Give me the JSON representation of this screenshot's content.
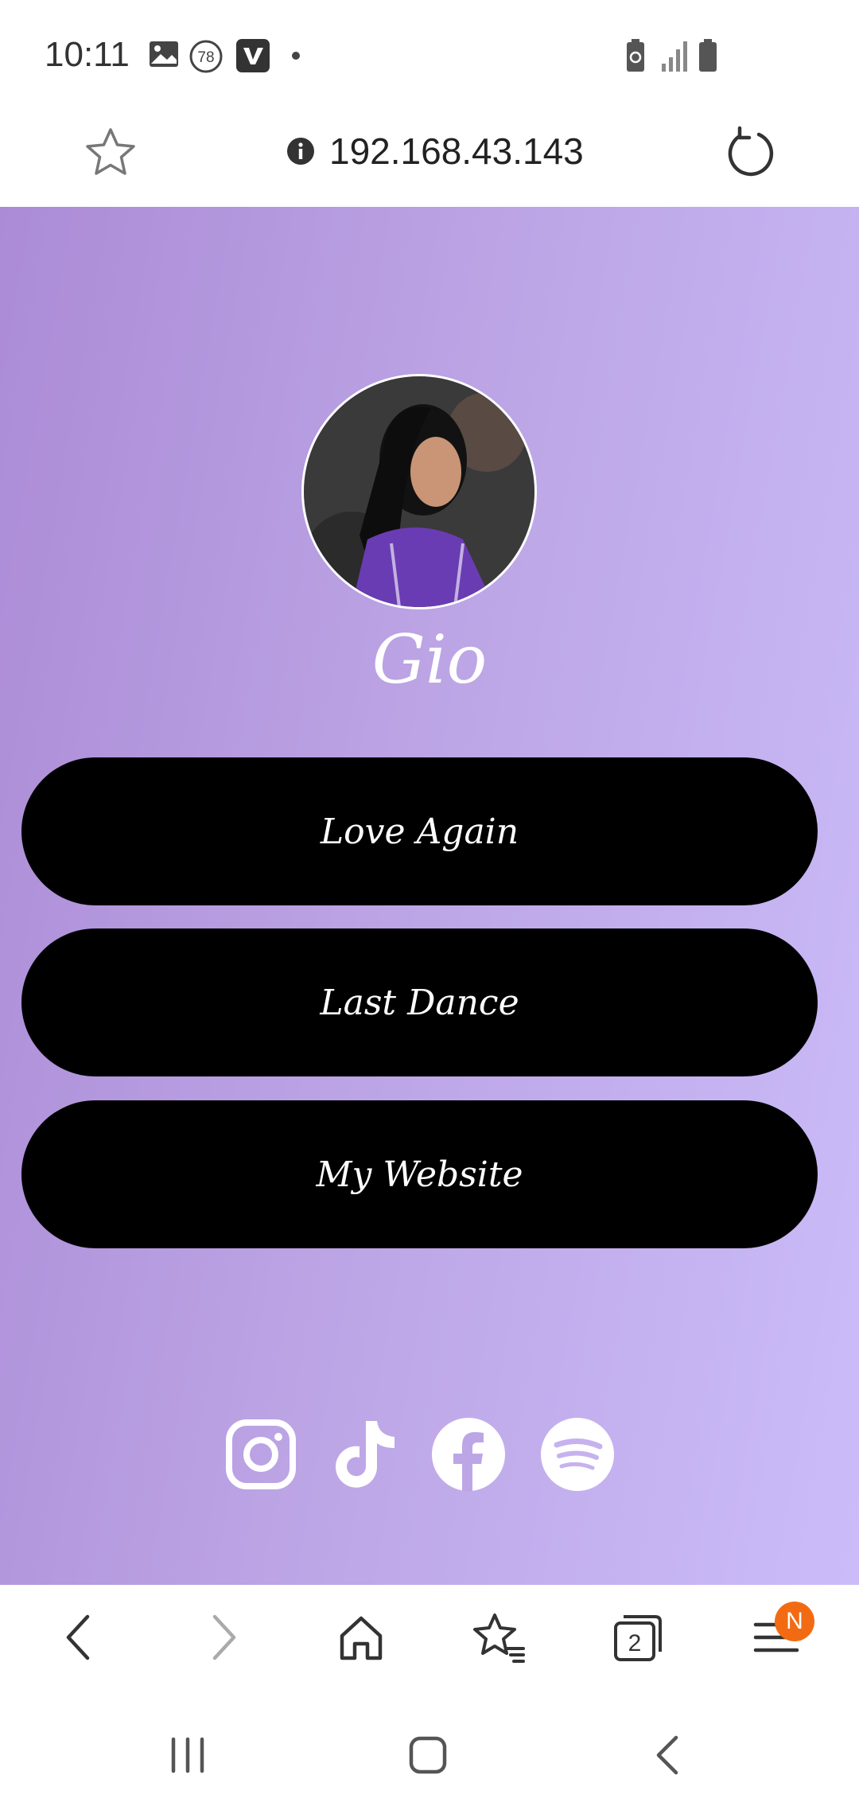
{
  "status_bar": {
    "time": "10:11",
    "notification_icons": [
      "image-icon",
      "badge-78-icon",
      "vimeo-icon",
      "dot-icon"
    ],
    "badge_number": "78",
    "right_icons": [
      "battery-saver-icon",
      "signal-icon",
      "battery-icon"
    ]
  },
  "address_bar": {
    "url": "192.168.43.143",
    "left_icon": "star-icon",
    "info_icon": "info-icon",
    "right_icon": "reload-icon"
  },
  "page": {
    "background_gradient": [
      "#ab8bd6",
      "#cbbcf9"
    ],
    "profile_name": "Gio",
    "links": [
      {
        "label": "Love Again"
      },
      {
        "label": "Last Dance"
      },
      {
        "label": "My Website"
      }
    ],
    "button_color": "#000000",
    "socials": [
      "instagram-icon",
      "tiktok-icon",
      "facebook-icon",
      "spotify-icon"
    ]
  },
  "bottom_nav": {
    "items": [
      "back-icon",
      "forward-icon",
      "home-icon",
      "bookmarks-icon",
      "tabs-icon",
      "menu-icon"
    ],
    "tabs_count": "2",
    "menu_badge": "N",
    "badge_color": "#f26b13"
  },
  "system_nav": {
    "items": [
      "recents-icon",
      "home-icon",
      "back-icon"
    ]
  }
}
